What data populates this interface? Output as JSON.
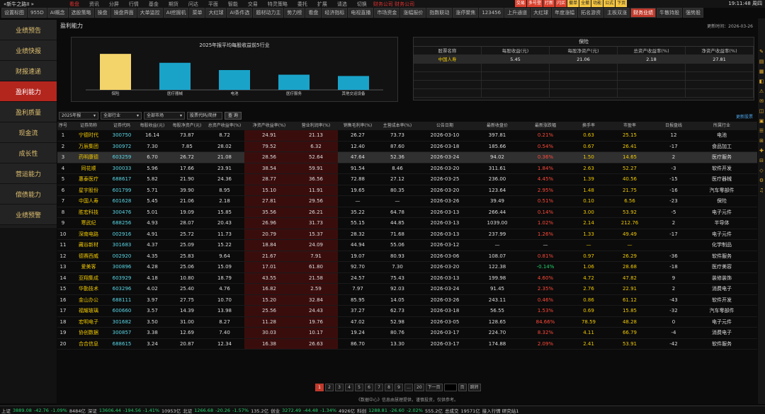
{
  "app": {
    "title": "«新牛之路II »",
    "clock": "19:11:48 周四"
  },
  "topmenu": [
    "看盘",
    "资讯",
    "分屏",
    "行情",
    "基金",
    "期货",
    "问达",
    "平面",
    "智能",
    "交易",
    "特灵策略",
    "委托",
    "扩展",
    "请选",
    "切换"
  ],
  "topmenu_alert": "财务公司 财务公司",
  "toolbuttons": [
    "交易",
    "多号登",
    "打新",
    "闪买",
    "撤单",
    "全撤",
    "功能",
    "公式",
    "下页"
  ],
  "tabs": [
    "设置标图",
    "955D",
    "AI概念",
    "选股策略",
    "操盘",
    "操盘界面",
    "大单监控",
    "AI挖掘机",
    "菜单",
    "大红球",
    "AI条件选",
    "题材动力主",
    "势力榜",
    "看盘",
    "经济指标",
    "电视直播",
    "市场资金",
    "涨幅报价",
    "指数联动",
    "涨停聚焦",
    "123456",
    "上升通道",
    "大红球",
    "年度涨幅",
    "拓名游资",
    "主板双涨",
    "财务业绩",
    "牛散持股",
    "强势股"
  ],
  "active_tab": "财务业绩",
  "sidebar": [
    "业绩预告",
    "业绩快报",
    "财报速递",
    "盈利能力",
    "盈利质量",
    "现金流",
    "成长性",
    "营运能力",
    "偿债能力",
    "业绩预警"
  ],
  "active_sidebar": "盈利能力",
  "section": {
    "title": "盈利能力",
    "update_time": "更新时间：2026-03-26"
  },
  "colors": {
    "bar_highlight": "#f3d46b",
    "bar_default": "#1aa3c9",
    "accent_red": "#c0392b"
  },
  "chart_data": {
    "type": "bar",
    "title": "2025年报平均每股收益前5行业",
    "categories": [
      "保险",
      "医疗器械",
      "电池",
      "医疗服务",
      "其他交运设备"
    ],
    "values": [
      5.45,
      4.1,
      3.0,
      2.3,
      2.1
    ],
    "ylim": [
      0,
      6
    ]
  },
  "insurance_panel": {
    "title": "保险",
    "headers": [
      "股票名称",
      "每股收益(元)",
      "每股净资产(元)",
      "总资产收益率(%)",
      "净资产收益率(%)"
    ],
    "row": [
      "中国人寿",
      "5.45",
      "21.06",
      "2.18",
      "27.81"
    ]
  },
  "filters": {
    "year": "2025年报",
    "industry": "全部行业",
    "market": "全部市场",
    "search_placeholder": "股票代码/简拼",
    "query": "查 询",
    "more": "更新股票"
  },
  "table": {
    "headers": [
      "序号",
      "证券简称",
      "证券代码",
      "每股收益(元)",
      "每股净资产(元)",
      "总资产收益率(%)",
      "净资产收益率(%)",
      "营业利润率(%)",
      "销售毛利率(%)",
      "主营成本率(%)",
      "公告日期",
      "最新收盘价",
      "最新涨跌幅",
      "换手率",
      "市盈率",
      "日报盘线",
      "所属行业"
    ],
    "rows": [
      [
        "1",
        "宁德时代",
        "300750",
        "16.14",
        "73.87",
        "8.72",
        "24.91",
        "21.13",
        "26.27",
        "73.73",
        "2026-03-10",
        "397.81",
        "0.21%",
        "0.63",
        "25.15",
        "12",
        "电池"
      ],
      [
        "2",
        "万辰集团",
        "300972",
        "7.30",
        "7.85",
        "28.02",
        "79.52",
        "6.32",
        "12.40",
        "87.60",
        "2026-03-18",
        "185.66",
        "0.54%",
        "0.67",
        "26.41",
        "-17",
        "食品加工"
      ],
      [
        "3",
        "药明康德",
        "603259",
        "6.70",
        "26.72",
        "21.08",
        "28.56",
        "52.64",
        "47.64",
        "52.36",
        "2026-03-24",
        "94.02",
        "0.36%",
        "1.50",
        "14.65",
        "2",
        "医疗服务"
      ],
      [
        "4",
        "同花顺",
        "300033",
        "5.96",
        "17.66",
        "23.91",
        "38.54",
        "59.91",
        "91.54",
        "8.46",
        "2026-03-20",
        "311.61",
        "1.84%",
        "2.63",
        "52.27",
        "-3",
        "软件开发"
      ],
      [
        "5",
        "惠泰医疗",
        "688617",
        "5.82",
        "21.90",
        "24.36",
        "28.77",
        "36.56",
        "72.88",
        "27.12",
        "2026-03-25",
        "236.00",
        "4.45%",
        "1.39",
        "40.56",
        "-15",
        "医疗器械"
      ],
      [
        "6",
        "星宇股份",
        "601799",
        "5.71",
        "39.90",
        "8.95",
        "15.10",
        "11.91",
        "19.65",
        "80.35",
        "2026-03-20",
        "123.64",
        "2.95%",
        "1.48",
        "21.75",
        "-16",
        "汽车零部件"
      ],
      [
        "7",
        "中国人寿",
        "601628",
        "5.45",
        "21.06",
        "2.18",
        "27.81",
        "29.56",
        "—",
        "—",
        "2026-03-26",
        "39.49",
        "0.51%",
        "0.10",
        "6.56",
        "-23",
        "保险"
      ],
      [
        "8",
        "胜宏科技",
        "300476",
        "5.01",
        "19.09",
        "15.85",
        "35.56",
        "26.21",
        "35.22",
        "64.78",
        "2026-03-13",
        "266.44",
        "0.14%",
        "3.00",
        "53.92",
        "-5",
        "电子元件"
      ],
      [
        "9",
        "寒武纪",
        "688256",
        "4.93",
        "28.07",
        "20.43",
        "26.96",
        "31.73",
        "55.15",
        "44.85",
        "2026-03-13",
        "1039.00",
        "1.02%",
        "2.14",
        "212.76",
        "2",
        "半导体"
      ],
      [
        "10",
        "深南电路",
        "002916",
        "4.91",
        "25.72",
        "11.73",
        "20.79",
        "15.37",
        "28.32",
        "71.68",
        "2026-03-13",
        "237.99",
        "1.26%",
        "1.33",
        "49.49",
        "-17",
        "电子元件"
      ],
      [
        "11",
        "藏谷新材",
        "301683",
        "4.37",
        "25.09",
        "15.22",
        "18.84",
        "24.09",
        "44.94",
        "55.06",
        "2026-03-12",
        "—",
        "—",
        "—",
        "—",
        "",
        "化学制品"
      ],
      [
        "12",
        "德赛西威",
        "002920",
        "4.35",
        "25.83",
        "9.64",
        "21.67",
        "7.91",
        "19.07",
        "80.93",
        "2026-03-06",
        "108.07",
        "0.81%",
        "0.97",
        "26.29",
        "-36",
        "软件服务"
      ],
      [
        "13",
        "爱美客",
        "300896",
        "4.28",
        "25.06",
        "15.09",
        "17.01",
        "61.80",
        "92.70",
        "7.30",
        "2026-03-20",
        "122.38",
        "-0.14%",
        "1.06",
        "28.68",
        "-18",
        "医疗美容"
      ],
      [
        "14",
        "亚翔集成",
        "603929",
        "4.18",
        "10.80",
        "18.79",
        "43.55",
        "21.58",
        "24.57",
        "75.43",
        "2026-03-13",
        "199.98",
        "4.60%",
        "4.72",
        "47.82",
        "9",
        "装修装饰"
      ],
      [
        "15",
        "华勤技术",
        "603296",
        "4.02",
        "25.40",
        "4.76",
        "16.82",
        "2.59",
        "7.97",
        "92.03",
        "2026-03-24",
        "91.45",
        "2.35%",
        "2.76",
        "22.91",
        "2",
        "消费电子"
      ],
      [
        "16",
        "金山办公",
        "688111",
        "3.97",
        "27.75",
        "10.70",
        "15.20",
        "32.84",
        "85.95",
        "14.05",
        "2026-03-26",
        "243.11",
        "0.46%",
        "0.86",
        "61.12",
        "-43",
        "软件开发"
      ],
      [
        "17",
        "福耀玻璃",
        "600660",
        "3.57",
        "14.39",
        "13.98",
        "25.56",
        "24.43",
        "37.27",
        "62.73",
        "2026-03-18",
        "56.55",
        "1.53%",
        "0.69",
        "15.85",
        "-32",
        "汽车零部件"
      ],
      [
        "18",
        "宏明电子",
        "301682",
        "3.50",
        "31.00",
        "8.27",
        "11.28",
        "19.76",
        "47.02",
        "52.98",
        "2026-03-05",
        "128.65",
        "84.66%",
        "78.59",
        "48.28",
        "0",
        "电子元件"
      ],
      [
        "19",
        "协创数据",
        "300857",
        "3.38",
        "12.69",
        "7.40",
        "30.03",
        "10.17",
        "19.24",
        "80.76",
        "2026-03-17",
        "224.70",
        "8.32%",
        "4.11",
        "66.79",
        "-4",
        "消费电子"
      ],
      [
        "20",
        "合合信息",
        "688615",
        "3.24",
        "20.87",
        "12.34",
        "16.38",
        "26.63",
        "86.70",
        "13.30",
        "2026-03-17",
        "174.88",
        "2.09%",
        "2.41",
        "53.91",
        "-42",
        "软件服务"
      ]
    ]
  },
  "pager": {
    "pages": [
      "1",
      "2",
      "3",
      "4",
      "5",
      "6",
      "7",
      "8",
      "9",
      "...",
      "20"
    ],
    "next": "下一页",
    "go": "跳转",
    "page_label": "页"
  },
  "footer_note": "《数据中心》信息由慧理提供，谨慎投资，仅供参考。",
  "statusbar": [
    {
      "t": "上证",
      "c": "#ccc"
    },
    {
      "t": "3889.08",
      "c": "#22d06a"
    },
    {
      "t": "-42.76",
      "c": "#22d06a"
    },
    {
      "t": "-1.09%",
      "c": "#22d06a"
    },
    {
      "t": "8484亿",
      "c": "#ccc"
    },
    {
      "t": "深证",
      "c": "#ccc"
    },
    {
      "t": "13606.44",
      "c": "#22d06a"
    },
    {
      "t": "-194.56",
      "c": "#22d06a"
    },
    {
      "t": "-1.41%",
      "c": "#22d06a"
    },
    {
      "t": "10953亿",
      "c": "#ccc"
    },
    {
      "t": "北证",
      "c": "#ccc"
    },
    {
      "t": "1266.68",
      "c": "#22d06a"
    },
    {
      "t": "-20.26",
      "c": "#22d06a"
    },
    {
      "t": "-1.57%",
      "c": "#22d06a"
    },
    {
      "t": "135.2亿",
      "c": "#ccc"
    },
    {
      "t": "创业",
      "c": "#ccc"
    },
    {
      "t": "3272.49",
      "c": "#22d06a"
    },
    {
      "t": "-44.48",
      "c": "#22d06a"
    },
    {
      "t": "-1.34%",
      "c": "#22d06a"
    },
    {
      "t": "4926亿",
      "c": "#ccc"
    },
    {
      "t": "科创",
      "c": "#ccc"
    },
    {
      "t": "1288.81",
      "c": "#22d06a"
    },
    {
      "t": "-26.60",
      "c": "#22d06a"
    },
    {
      "t": "-2.02%",
      "c": "#22d06a"
    },
    {
      "t": "555.2亿",
      "c": "#ccc"
    },
    {
      "t": "总成交",
      "c": "#ccc"
    },
    {
      "t": "19571亿",
      "c": "#ccc"
    },
    {
      "t": "接入行情 研究站1",
      "c": "#ccc"
    }
  ]
}
